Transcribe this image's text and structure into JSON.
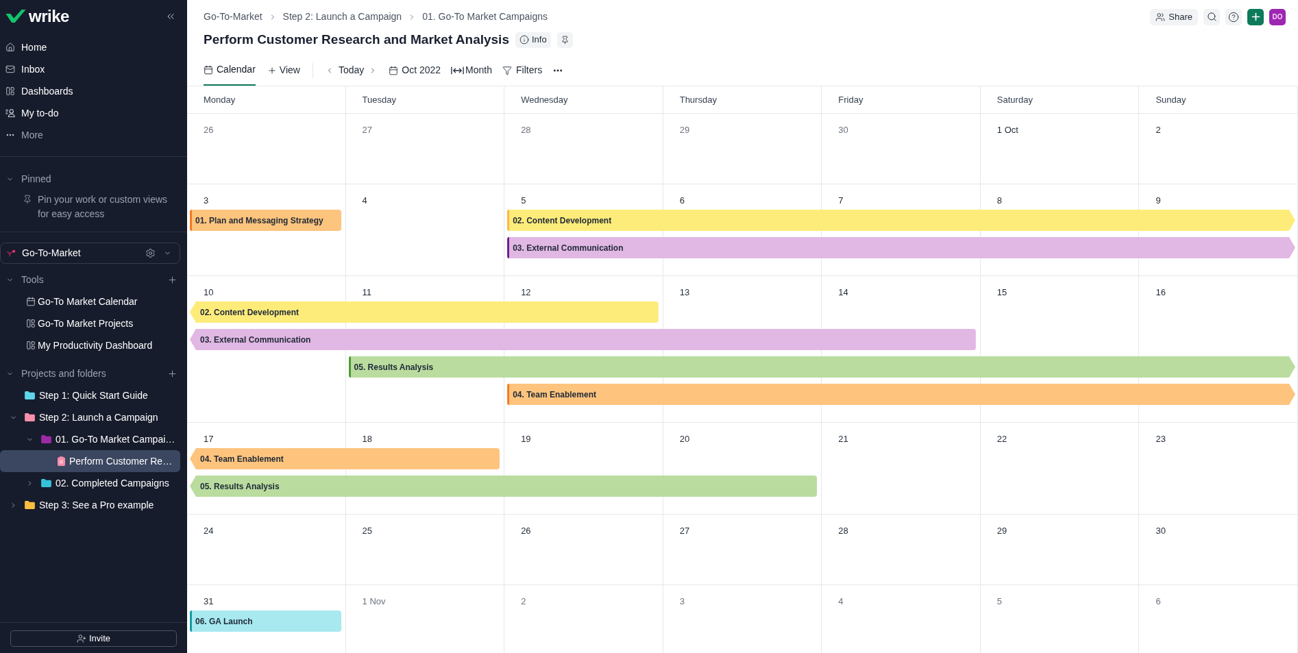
{
  "sidebar": {
    "logo": "wrike",
    "nav": [
      {
        "label": "Home",
        "kind": "home"
      },
      {
        "label": "Inbox",
        "kind": "inbox"
      },
      {
        "label": "Dashboards",
        "kind": "dashboards"
      },
      {
        "label": "My to-do",
        "kind": "todo"
      },
      {
        "label": "More",
        "kind": "more"
      }
    ],
    "pinned": {
      "title": "Pinned",
      "expanded": true,
      "hint": "Pin your work or custom views for easy access"
    },
    "space": {
      "name": "Go-To-Market"
    },
    "tools": {
      "title": "Tools",
      "expanded": true,
      "items": [
        {
          "label": "Go-To Market Calendar",
          "kind": "calendar"
        },
        {
          "label": "Go-To Market Projects",
          "kind": "board"
        },
        {
          "label": "My Productivity Dashboard",
          "kind": "board"
        }
      ]
    },
    "projects": {
      "title": "Projects and folders",
      "expanded": true,
      "items": [
        {
          "label": "Step 1: Quick Start Guide",
          "kind": "folder",
          "color": "#5ed6e9",
          "selected": false
        },
        {
          "label": "Step 2: Launch a Campaign",
          "kind": "folder",
          "color": "#f58fab",
          "expanded": true,
          "selected": false,
          "children": [
            {
              "label": "01. Go-To Market Campai…",
              "kind": "folder",
              "color": "#9b2aa6",
              "expanded": true,
              "selected": false,
              "children": [
                {
                  "label": "Perform Customer Re…",
                  "kind": "task",
                  "color": "#f58fab",
                  "selected": true
                }
              ]
            },
            {
              "label": "02. Completed Campaigns",
              "kind": "folder",
              "color": "#36c3d9",
              "expanded": false,
              "selected": false
            }
          ]
        },
        {
          "label": "Step 3: See a Pro example",
          "kind": "folder",
          "color": "#fbbd3d",
          "expanded": false,
          "selected": false
        }
      ]
    },
    "invite": "Invite"
  },
  "header": {
    "breadcrumb": [
      "Go-To-Market",
      "Step 2: Launch a Campaign",
      "01. Go-To Market Campaigns"
    ],
    "title": "Perform Customer Research and Market Analysis",
    "info": "Info",
    "share": "Share",
    "avatar": "DO"
  },
  "toolbar": {
    "views": [
      {
        "label": "Calendar",
        "selected": true
      }
    ],
    "add_view": "View",
    "today": "Today",
    "period": "Oct 2022",
    "scale": "Month",
    "filters": "Filters"
  },
  "calendar": {
    "weekdays": [
      "Monday",
      "Tuesday",
      "Wednesday",
      "Thursday",
      "Friday",
      "Saturday",
      "Sunday"
    ],
    "weeks": [
      {
        "days": [
          {
            "label": "26",
            "in_month": false
          },
          {
            "label": "27",
            "in_month": false
          },
          {
            "label": "28",
            "in_month": false
          },
          {
            "label": "29",
            "in_month": false
          },
          {
            "label": "30",
            "in_month": false
          },
          {
            "label": "1 Oct",
            "in_month": true
          },
          {
            "label": "2",
            "in_month": true
          }
        ]
      },
      {
        "days": [
          {
            "label": "3",
            "in_month": true
          },
          {
            "label": "4",
            "in_month": true
          },
          {
            "label": "5",
            "in_month": true
          },
          {
            "label": "6",
            "in_month": true
          },
          {
            "label": "7",
            "in_month": true
          },
          {
            "label": "8",
            "in_month": true
          },
          {
            "label": "9",
            "in_month": true
          }
        ],
        "lanes": [
          {
            "slots": [
              {
                "kind": "event",
                "event": {
                  "title": "01. Plan and Messaging Strategy",
                  "color": "#fdc47d",
                  "stripe": {
                    "color": "#f37a22"
                  },
                  "continues_before": false,
                  "continues_after": false
                }
              },
              {
                "kind": "empty"
              },
              {
                "kind": "event",
                "event": {
                  "title": "02. Content Development",
                  "color": "#feec7a",
                  "stripe": {
                    "color": "#f9b648"
                  },
                  "continues_before": false,
                  "continues_after": true
                }
              },
              {
                "kind": "span"
              },
              {
                "kind": "span"
              },
              {
                "kind": "span"
              },
              {
                "kind": "span"
              }
            ]
          },
          {
            "slots": [
              {
                "kind": "empty"
              },
              {
                "kind": "empty"
              },
              {
                "kind": "event",
                "event": {
                  "title": "03. External Communication",
                  "color": "#e1b7e3",
                  "stripe": {
                    "color": "#6b1d8b"
                  },
                  "continues_before": false,
                  "continues_after": true
                }
              },
              {
                "kind": "span"
              },
              {
                "kind": "span"
              },
              {
                "kind": "span"
              },
              {
                "kind": "span"
              }
            ]
          }
        ]
      },
      {
        "days": [
          {
            "label": "10",
            "in_month": true
          },
          {
            "label": "11",
            "in_month": true
          },
          {
            "label": "12",
            "in_month": true
          },
          {
            "label": "13",
            "in_month": true
          },
          {
            "label": "14",
            "in_month": true
          },
          {
            "label": "15",
            "in_month": true
          },
          {
            "label": "16",
            "in_month": true
          }
        ],
        "lanes": [
          {
            "slots": [
              {
                "kind": "event",
                "event": {
                  "title": "02. Content Development",
                  "color": "#feec7a",
                  "continues_before": true,
                  "continues_after": false
                }
              },
              {
                "kind": "span"
              },
              {
                "kind": "span"
              },
              {
                "kind": "empty"
              },
              {
                "kind": "empty"
              },
              {
                "kind": "empty"
              },
              {
                "kind": "empty"
              }
            ]
          },
          {
            "slots": [
              {
                "kind": "event",
                "event": {
                  "title": "03. External Communication",
                  "color": "#e1b7e3",
                  "continues_before": true,
                  "continues_after": false
                }
              },
              {
                "kind": "span"
              },
              {
                "kind": "span"
              },
              {
                "kind": "span"
              },
              {
                "kind": "span"
              },
              {
                "kind": "empty"
              },
              {
                "kind": "empty"
              }
            ]
          },
          {
            "slots": [
              {
                "kind": "empty"
              },
              {
                "kind": "event",
                "event": {
                  "title": "05. Results Analysis",
                  "color": "#badc9f",
                  "stripe": {
                    "color": "#4f9a37"
                  },
                  "continues_before": false,
                  "continues_after": true
                }
              },
              {
                "kind": "span"
              },
              {
                "kind": "span"
              },
              {
                "kind": "span"
              },
              {
                "kind": "span"
              },
              {
                "kind": "span"
              }
            ]
          },
          {
            "slots": [
              {
                "kind": "empty"
              },
              {
                "kind": "empty"
              },
              {
                "kind": "event",
                "event": {
                  "title": "04. Team Enablement",
                  "color": "#fec47d",
                  "stripe": {
                    "color": "#f37a22"
                  },
                  "continues_before": false,
                  "continues_after": true
                }
              },
              {
                "kind": "span"
              },
              {
                "kind": "span"
              },
              {
                "kind": "span"
              },
              {
                "kind": "span"
              }
            ]
          }
        ]
      },
      {
        "days": [
          {
            "label": "17",
            "in_month": true
          },
          {
            "label": "18",
            "in_month": true
          },
          {
            "label": "19",
            "in_month": true
          },
          {
            "label": "20",
            "in_month": true
          },
          {
            "label": "21",
            "in_month": true
          },
          {
            "label": "22",
            "in_month": true
          },
          {
            "label": "23",
            "in_month": true
          }
        ],
        "lanes": [
          {
            "slots": [
              {
                "kind": "event",
                "event": {
                  "title": "04. Team Enablement",
                  "color": "#fec47d",
                  "continues_before": true,
                  "continues_after": false
                }
              },
              {
                "kind": "span"
              },
              {
                "kind": "empty"
              },
              {
                "kind": "empty"
              },
              {
                "kind": "empty"
              },
              {
                "kind": "empty"
              },
              {
                "kind": "empty"
              }
            ]
          },
          {
            "slots": [
              {
                "kind": "event",
                "event": {
                  "title": "05. Results Analysis",
                  "color": "#badc9f",
                  "continues_before": true,
                  "continues_after": false
                }
              },
              {
                "kind": "span"
              },
              {
                "kind": "span"
              },
              {
                "kind": "span"
              },
              {
                "kind": "empty"
              },
              {
                "kind": "empty"
              },
              {
                "kind": "empty"
              }
            ]
          }
        ]
      },
      {
        "days": [
          {
            "label": "24",
            "in_month": true
          },
          {
            "label": "25",
            "in_month": true
          },
          {
            "label": "26",
            "in_month": true
          },
          {
            "label": "27",
            "in_month": true
          },
          {
            "label": "28",
            "in_month": true
          },
          {
            "label": "29",
            "in_month": true
          },
          {
            "label": "30",
            "in_month": true
          }
        ]
      },
      {
        "days": [
          {
            "label": "31",
            "in_month": true
          },
          {
            "label": "1 Nov",
            "in_month": false
          },
          {
            "label": "2",
            "in_month": false
          },
          {
            "label": "3",
            "in_month": false
          },
          {
            "label": "4",
            "in_month": false
          },
          {
            "label": "5",
            "in_month": false
          },
          {
            "label": "6",
            "in_month": false
          }
        ],
        "lanes": [
          {
            "slots": [
              {
                "kind": "event",
                "event": {
                  "title": "06. GA Launch",
                  "color": "#a7e9ef",
                  "stripe": {
                    "color": "#159ca3"
                  },
                  "continues_before": false,
                  "continues_after": false
                }
              },
              {
                "kind": "empty"
              },
              {
                "kind": "empty"
              },
              {
                "kind": "empty"
              },
              {
                "kind": "empty"
              },
              {
                "kind": "empty"
              },
              {
                "kind": "empty"
              }
            ]
          }
        ]
      }
    ]
  }
}
